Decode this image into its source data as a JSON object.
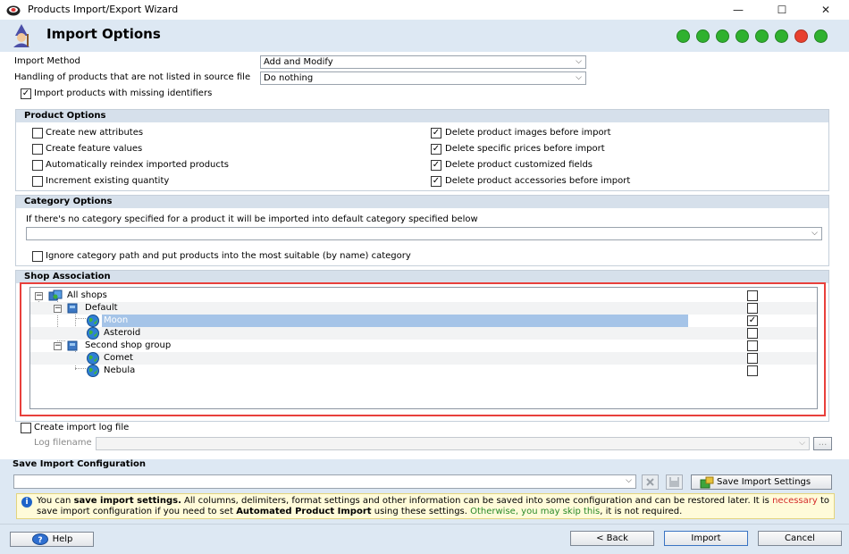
{
  "window": {
    "title": "Products Import/Export Wizard",
    "minimize": "—",
    "maximize": "☐",
    "close": "✕"
  },
  "header": {
    "page_title": "Import Options",
    "step_colors": [
      "#2fb12f",
      "#2fb12f",
      "#2fb12f",
      "#2fb12f",
      "#2fb12f",
      "#2fb12f",
      "#e8402e",
      "#2fb12f"
    ]
  },
  "import_method": {
    "label": "Import Method",
    "value": "Add and Modify"
  },
  "handling": {
    "label": "Handling of products that are not listed in source file",
    "value": "Do nothing"
  },
  "missing_ids": {
    "label": "Import products with missing identifiers",
    "checked": true
  },
  "product_options": {
    "title": "Product Options",
    "left": [
      {
        "label": "Create new attributes",
        "checked": false
      },
      {
        "label": "Create feature values",
        "checked": false
      },
      {
        "label": "Automatically reindex imported products",
        "checked": false
      },
      {
        "label": "Increment existing quantity",
        "checked": false
      }
    ],
    "right": [
      {
        "label": "Delete product images before import",
        "checked": true
      },
      {
        "label": "Delete specific prices before import",
        "checked": true
      },
      {
        "label": "Delete product customized fields",
        "checked": true
      },
      {
        "label": "Delete product accessories before import",
        "checked": true
      }
    ]
  },
  "category_options": {
    "title": "Category Options",
    "hint": "If there's no category specified for a product it will be imported into default category specified below",
    "value": "",
    "ignore_label": "Ignore category path and put products into the most suitable (by name) category",
    "ignore_checked": false
  },
  "shop_association": {
    "title": "Shop Association",
    "nodes": [
      {
        "label": "All shops",
        "checked": false
      },
      {
        "label": "Default",
        "checked": false
      },
      {
        "label": "Moon",
        "checked": true,
        "selected": true
      },
      {
        "label": "Asteroid",
        "checked": false
      },
      {
        "label": "Second shop group",
        "checked": false
      },
      {
        "label": "Comet",
        "checked": false
      },
      {
        "label": "Nebula",
        "checked": false
      }
    ]
  },
  "log": {
    "create_label": "Create import log file",
    "create_checked": false,
    "filename_label": "Log filename",
    "filename_value": "",
    "browse_label": "..."
  },
  "save_config": {
    "title": "Save Import Configuration",
    "value": "",
    "save_button": "Save Import Settings",
    "info": {
      "p1": "You can ",
      "b1": "save import settings.",
      "p2": " All columns, delimiters, format settings and other information can be saved into some configuration and can be restored later. It is ",
      "red": "necessary",
      "p3": " to save import configuration if you need to set ",
      "b2": "Automated Product Import",
      "p4": " using these settings. ",
      "green": "Otherwise, you may skip this",
      "p5": ", it is not required."
    }
  },
  "footer": {
    "help": "Help",
    "back": "< Back",
    "import": "Import",
    "cancel": "Cancel"
  }
}
